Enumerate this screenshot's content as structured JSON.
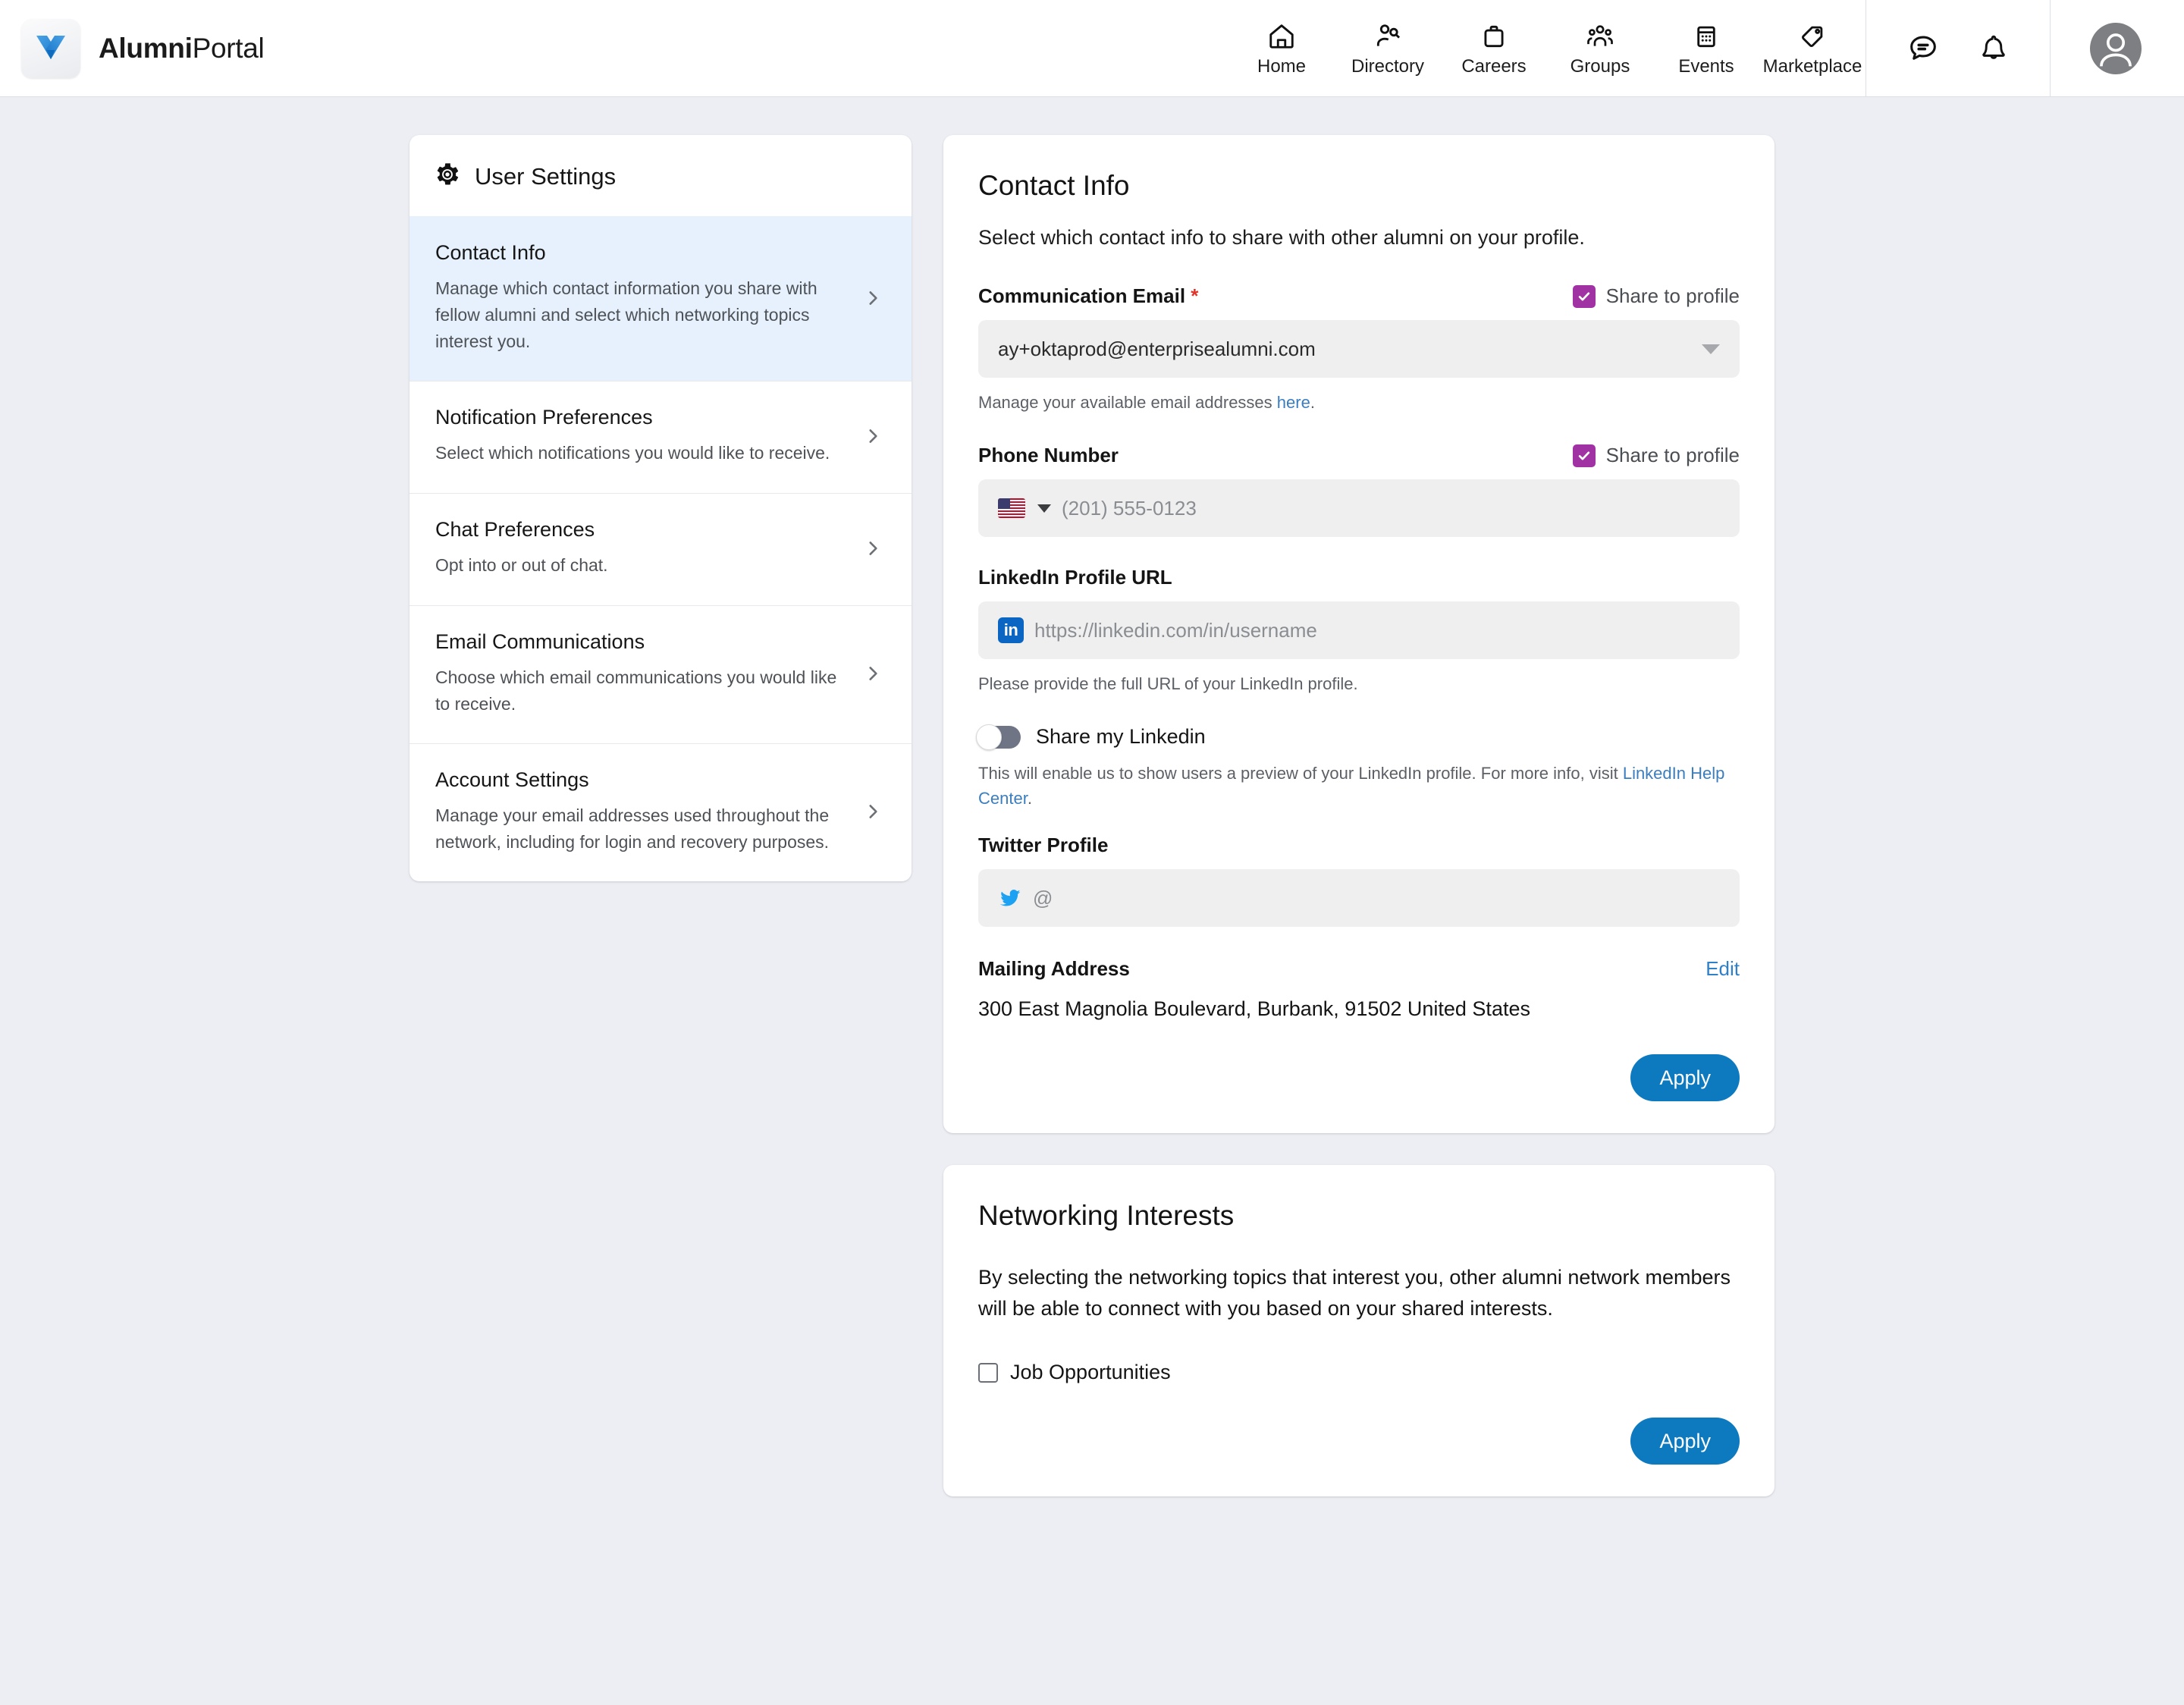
{
  "brand": {
    "bold": "Alumni",
    "regular": "Portal",
    "logo_icon": "y-logo-icon"
  },
  "topnav": {
    "items": [
      {
        "label": "Home",
        "icon": "home-icon"
      },
      {
        "label": "Directory",
        "icon": "directory-person-search-icon"
      },
      {
        "label": "Careers",
        "icon": "briefcase-icon"
      },
      {
        "label": "Groups",
        "icon": "people-group-icon"
      },
      {
        "label": "Events",
        "icon": "calendar-icon"
      },
      {
        "label": "Marketplace",
        "icon": "tag-icon"
      }
    ],
    "chat_icon": "chat-bubble-icon",
    "bell_icon": "bell-notification-icon",
    "avatar_icon": "user-avatar-icon"
  },
  "sidebar": {
    "header": {
      "title": "User Settings",
      "icon": "gear-icon"
    },
    "items": [
      {
        "title": "Contact Info",
        "desc": "Manage which contact information you share with fellow alumni and select which networking topics interest you.",
        "active": true
      },
      {
        "title": "Notification Preferences",
        "desc": "Select which notifications you would like to receive.",
        "active": false
      },
      {
        "title": "Chat Preferences",
        "desc": "Opt into or out of chat.",
        "active": false
      },
      {
        "title": "Email Communications",
        "desc": "Choose which email communications you would like to receive.",
        "active": false
      },
      {
        "title": "Account Settings",
        "desc": "Manage your email addresses used throughout the network, including for login and recovery purposes.",
        "active": false
      }
    ]
  },
  "contact_info": {
    "title": "Contact Info",
    "subtitle": "Select which contact info to share with other alumni on your profile.",
    "email": {
      "label": "Communication Email",
      "required_mark": "*",
      "share_label": "Share to profile",
      "share_checked": true,
      "value": "ay+oktaprod@enterprisealumni.com",
      "help_prefix": "Manage your available email addresses ",
      "help_link": "here",
      "help_suffix": "."
    },
    "phone": {
      "label": "Phone Number",
      "share_label": "Share to profile",
      "share_checked": true,
      "country_flag": "us-flag-icon",
      "placeholder": "(201) 555-0123",
      "value": ""
    },
    "linkedin": {
      "label": "LinkedIn Profile URL",
      "icon_text": "in",
      "placeholder": "https://linkedin.com/in/username",
      "value": "",
      "help": "Please provide the full URL of your LinkedIn profile.",
      "toggle_label": "Share my Linkedin",
      "toggle_on": false,
      "note_prefix": "This will enable us to show users a preview of your LinkedIn profile. For more info, visit ",
      "note_link": "LinkedIn Help Center",
      "note_suffix": "."
    },
    "twitter": {
      "label": "Twitter Profile",
      "icon": "twitter-bird-icon",
      "placeholder": "@",
      "value": ""
    },
    "mailing": {
      "label": "Mailing Address",
      "edit_label": "Edit",
      "address": "300 East Magnolia Boulevard, Burbank, 91502 United States"
    },
    "apply_label": "Apply"
  },
  "networking": {
    "title": "Networking Interests",
    "desc": "By selecting the networking topics that interest you, other alumni network members will be able to connect with you based on your shared interests.",
    "options": [
      {
        "label": "Job Opportunities",
        "checked": false
      }
    ],
    "apply_label": "Apply"
  },
  "colors": {
    "page_bg": "#eceef3",
    "accent_blue": "#0d7ac0",
    "link_blue": "#3b7ec0",
    "checkbox_purple": "#a132a4",
    "required_red": "#e0342b",
    "linkedin_blue": "#0a66c2",
    "twitter_blue": "#1da1f2"
  }
}
